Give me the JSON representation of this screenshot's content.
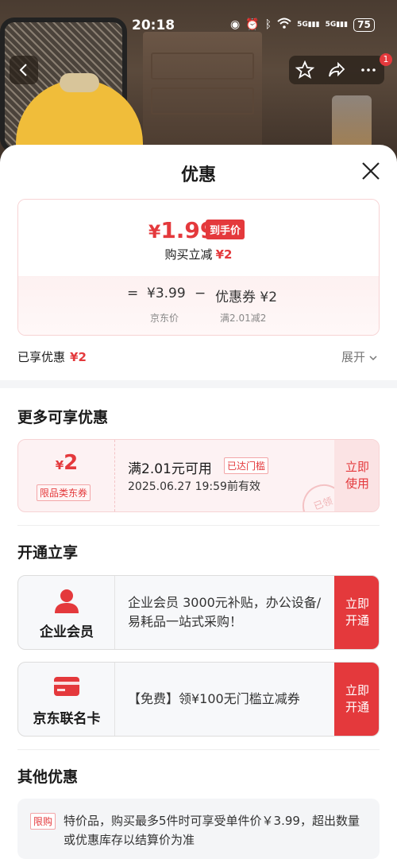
{
  "status_bar": {
    "time": "20:18",
    "signal_1": "5G",
    "signal_2": "5G",
    "battery": "75"
  },
  "nav": {
    "badge": "1"
  },
  "sheet": {
    "title": "优惠"
  },
  "price": {
    "currency": "¥",
    "final": "1.99",
    "tag": "到手价",
    "reduce_label": "购买立减",
    "reduce_amount": "¥2",
    "eq": "=",
    "jd_price": "¥3.99",
    "minus": "−",
    "coupon_part": "优惠券 ¥2",
    "jd_price_label": "京东价",
    "coupon_condition": "满2.01减2"
  },
  "enjoyed": {
    "label": "已享优惠",
    "amount": "¥2",
    "expand": "展开"
  },
  "more": {
    "title": "更多可享优惠",
    "coupon": {
      "currency": "¥",
      "amount": "2",
      "kind": "限品类东券",
      "condition": "满2.01元可用",
      "reached": "已达门槛",
      "valid": "2025.06.27 19:59前有效",
      "use_line1": "立即",
      "use_line2": "使用",
      "stamp": "已领"
    }
  },
  "open": {
    "title": "开通立享",
    "cards": [
      {
        "name": "企业会员",
        "desc": "企业会员 3000元补贴，办公设备/易耗品一站式采购！",
        "btn1": "立即",
        "btn2": "开通"
      },
      {
        "name": "京东联名卡",
        "desc": "【免费】领¥100无门槛立减券",
        "btn1": "立即",
        "btn2": "开通"
      }
    ]
  },
  "other": {
    "title": "其他优惠",
    "tag": "限购",
    "text": "特价品，购买最多5件时可享受单件价￥3.99，超出数量或优惠库存以结算价为准"
  },
  "colors": {
    "accent": "#e4393c",
    "pink_bg": "#fdf2f3"
  }
}
